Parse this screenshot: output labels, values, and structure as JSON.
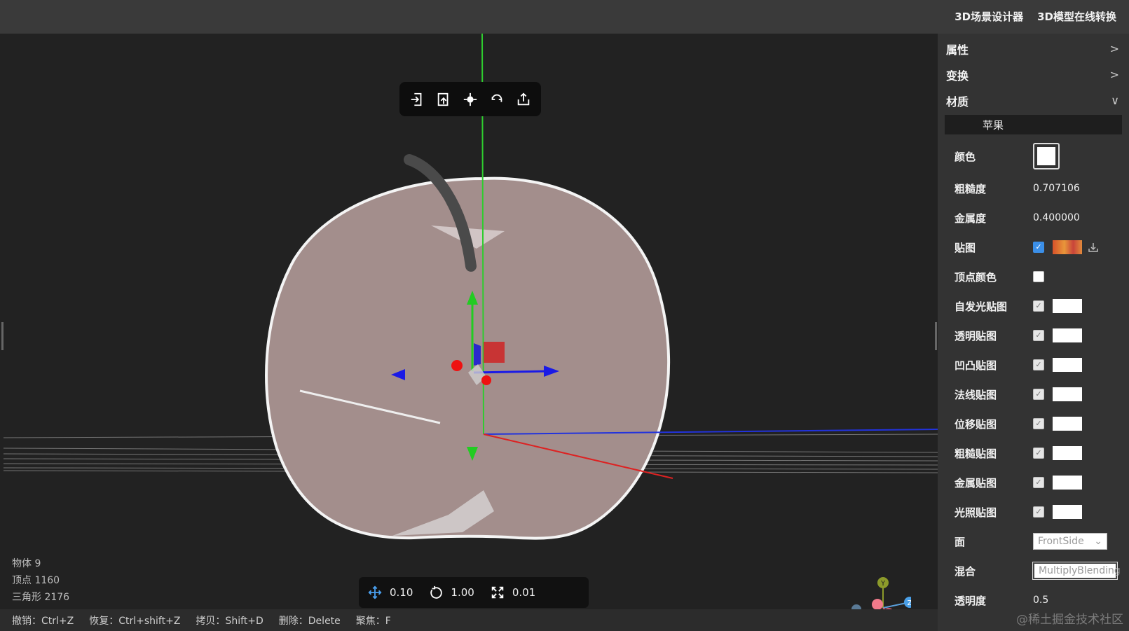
{
  "topnav": [
    "3D场景设计器",
    "3D模型在线转换"
  ],
  "toolbar": {
    "icons": [
      "import-icon",
      "import-model-icon",
      "center-icon",
      "reset-icon",
      "export-icon"
    ]
  },
  "stats": {
    "objects": "物体 9",
    "vertices": "顶点 1160",
    "triangles": "三角形 2176"
  },
  "gizmo_bar": {
    "translate_snap": "0.10",
    "rotate_snap": "1.00",
    "scale_snap": "0.01"
  },
  "shortcuts": [
    "撤销：Ctrl+Z",
    "恢复：Ctrl+shift+Z",
    "拷贝：Shift+D",
    "删除：Delete",
    "聚焦：F"
  ],
  "axis_labels": {
    "y": "Y",
    "z": "Z",
    "x": "X"
  },
  "panel": {
    "sections": {
      "properties": "属性",
      "transform": "变换",
      "material": "材质"
    },
    "chevrons": {
      "properties": ">",
      "transform": ">",
      "material": "∨"
    },
    "material_name": "苹果",
    "color_label": "颜色",
    "roughness_label": "粗糙度",
    "roughness_value": "0.707106",
    "metalness_label": "金属度",
    "metalness_value": "0.400000",
    "map_label": "贴图",
    "vertex_color_label": "顶点颜色",
    "maps": [
      {
        "label": "自发光贴图"
      },
      {
        "label": "透明贴图"
      },
      {
        "label": "凹凸贴图"
      },
      {
        "label": "法线贴图"
      },
      {
        "label": "位移贴图"
      },
      {
        "label": "粗糙贴图"
      },
      {
        "label": "金属贴图"
      },
      {
        "label": "光照贴图"
      }
    ],
    "side_label": "面",
    "side_value": "FrontSide",
    "blending_label": "混合",
    "blending_value": "MultiplyBlending",
    "opacity_label": "透明度",
    "opacity_value": "0.5"
  },
  "watermark": "@稀土掘金技术社区"
}
